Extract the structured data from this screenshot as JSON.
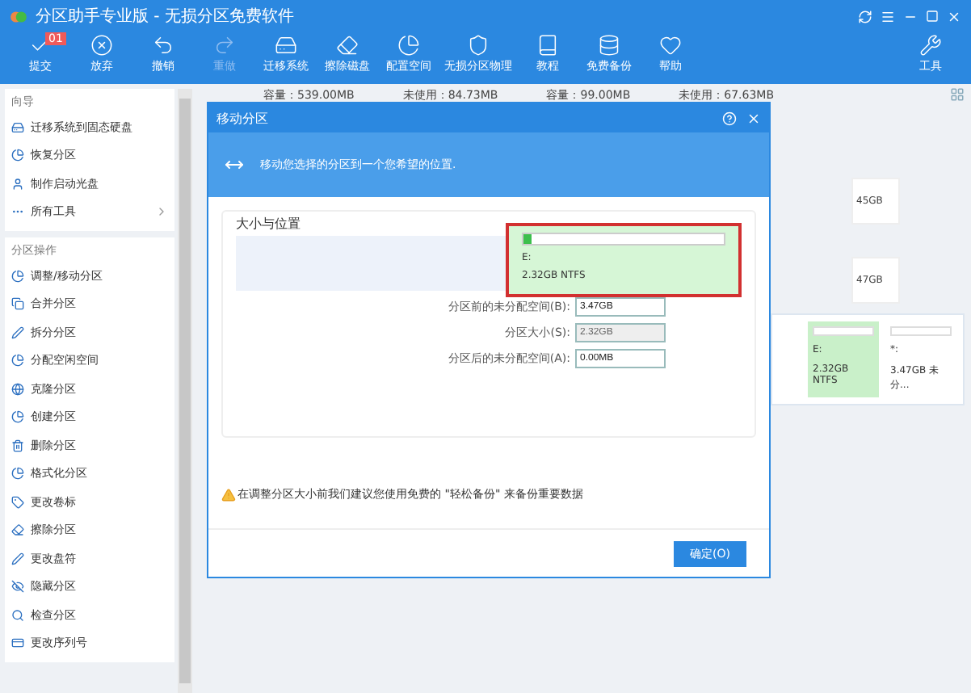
{
  "window": {
    "title": "分区助手专业版 - 无损分区免费软件"
  },
  "toolbar": [
    {
      "label": "提交",
      "disabled": false,
      "badge": "01"
    },
    {
      "label": "放弃",
      "disabled": false
    },
    {
      "label": "撤销",
      "disabled": false
    },
    {
      "label": "重做",
      "disabled": true
    },
    {
      "label": "迁移系统",
      "disabled": false
    },
    {
      "label": "擦除磁盘",
      "disabled": false
    },
    {
      "label": "配置空间",
      "disabled": false
    },
    {
      "label": "无损分区物理",
      "disabled": false
    },
    {
      "label": "教程",
      "disabled": false
    },
    {
      "label": "免费备份",
      "disabled": false
    },
    {
      "label": "帮助",
      "disabled": false
    }
  ],
  "tools_button": {
    "label": "工具"
  },
  "sidebar": {
    "sections": [
      {
        "title": "向导",
        "items": [
          {
            "label": "迁移系统到固态硬盘"
          },
          {
            "label": "恢复分区"
          },
          {
            "label": "制作启动光盘"
          },
          {
            "label": "所有工具",
            "submenu": true
          }
        ]
      },
      {
        "title": "分区操作",
        "items": [
          {
            "label": "调整/移动分区"
          },
          {
            "label": "合并分区"
          },
          {
            "label": "拆分分区"
          },
          {
            "label": "分配空闲空间"
          },
          {
            "label": "克隆分区"
          },
          {
            "label": "创建分区"
          },
          {
            "label": "删除分区"
          },
          {
            "label": "格式化分区"
          },
          {
            "label": "更改卷标"
          },
          {
            "label": "擦除分区"
          },
          {
            "label": "更改盘符"
          },
          {
            "label": "隐藏分区"
          },
          {
            "label": "检查分区"
          },
          {
            "label": "更改序列号"
          }
        ]
      }
    ]
  },
  "background": {
    "capacity_row": [
      "容量：539.00MB",
      "未使用：84.73MB",
      "容量：99.00MB",
      "未使用：67.63MB"
    ],
    "card_sizes": [
      "45GB",
      "47GB"
    ],
    "map_cells": [
      {
        "letter": "E:",
        "info": "2.32GB NTFS",
        "selected": true
      },
      {
        "letter": "*:",
        "info": "3.47GB 未分...",
        "selected": false
      }
    ]
  },
  "dialog": {
    "title": "移动分区",
    "banner": "移动您选择的分区到一个您希望的位置.",
    "group_title": "大小与位置",
    "partition": {
      "letter": "E:",
      "info": "2.32GB NTFS",
      "level": 0.04
    },
    "fields": [
      {
        "label": "分区前的未分配空间(B):",
        "value": "3.47GB",
        "disabled": false
      },
      {
        "label": "分区大小(S):",
        "value": "2.32GB",
        "disabled": true
      },
      {
        "label": "分区后的未分配空间(A):",
        "value": "0.00MB",
        "disabled": false
      }
    ],
    "warning": "在调整分区大小前我们建议您使用免费的 \"轻松备份\" 来备份重要数据",
    "ok": "确定(O)"
  }
}
